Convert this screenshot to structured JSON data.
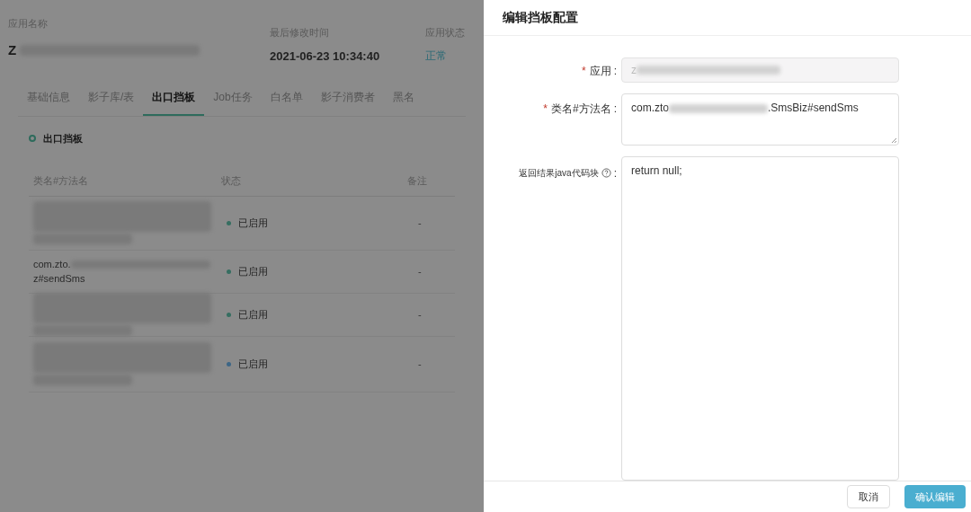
{
  "app_info": {
    "name_label": "应用名称",
    "name": "Z",
    "modified_label": "最后修改时间",
    "modified_time": "2021-06-23 10:34:40",
    "status_label": "应用状态",
    "status": "正常"
  },
  "tabs": [
    {
      "label": "基础信息",
      "selected": false
    },
    {
      "label": "影子库/表",
      "selected": false
    },
    {
      "label": "出口挡板",
      "selected": true
    },
    {
      "label": "Job任务",
      "selected": false
    },
    {
      "label": "白名单",
      "selected": false
    },
    {
      "label": "影子消费者",
      "selected": false
    },
    {
      "label": "黑名",
      "selected": false
    }
  ],
  "section_title": "出口挡板",
  "table": {
    "columns": [
      "类名#方法名",
      "状态",
      "备注"
    ],
    "rows": [
      {
        "kind": "redacted",
        "status": "已启用",
        "color": "#366e61",
        "remark": "-"
      },
      {
        "kind": "text",
        "name_prefix": "com.zto.",
        "name_suffix": "z#sendSms",
        "status": "已启用",
        "color": "#366e61",
        "remark": "-"
      },
      {
        "kind": "redacted",
        "status": "已启用",
        "color": "#366e61",
        "remark": "-"
      },
      {
        "kind": "redacted",
        "status": "已启用",
        "color": "#3d6686",
        "remark": "-"
      }
    ]
  },
  "drawer": {
    "title": "编辑挡板配置",
    "required_mark": "*",
    "label_suffix": ":",
    "fields": [
      {
        "kind": "input",
        "label": "应用",
        "required": true,
        "disabled": true,
        "value_prefix": "z"
      },
      {
        "kind": "textarea",
        "label": "类名#方法名",
        "required": true,
        "disabled": false,
        "value_prefix": "com.zto",
        "value_suffix": ".SmsBiz#sendSms"
      },
      {
        "kind": "code",
        "label": "返回结果java代码块",
        "required": false,
        "help": true,
        "disabled": false,
        "value": "return null;"
      }
    ],
    "buttons": [
      {
        "label": "取消",
        "kind": "default"
      },
      {
        "label": "确认编辑",
        "kind": "primary"
      }
    ]
  }
}
